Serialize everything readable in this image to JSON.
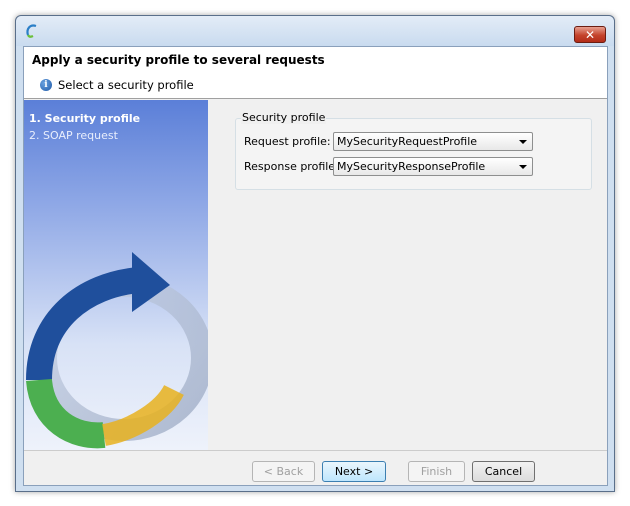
{
  "window": {
    "close_label": "✕"
  },
  "header": {
    "title": "Apply a security profile to several requests",
    "subtitle": "Select a security profile",
    "info_icon": "i"
  },
  "steps": [
    {
      "label": "1. Security profile",
      "active": true
    },
    {
      "label": "2. SOAP request",
      "active": false
    }
  ],
  "security_profile": {
    "group_title": "Security profile",
    "request_label": "Request profile:",
    "request_value": "MySecurityRequestProfile",
    "response_label": "Response profile:",
    "response_value": "MySecurityResponseProfile"
  },
  "buttons": {
    "back": "< Back",
    "next": "Next >",
    "finish": "Finish",
    "cancel": "Cancel"
  },
  "colors": {
    "accent_blue": "#1f5aa8",
    "arrow_green": "#4caf50",
    "arrow_yellow": "#e8b21f",
    "close_red": "#c4432c"
  }
}
